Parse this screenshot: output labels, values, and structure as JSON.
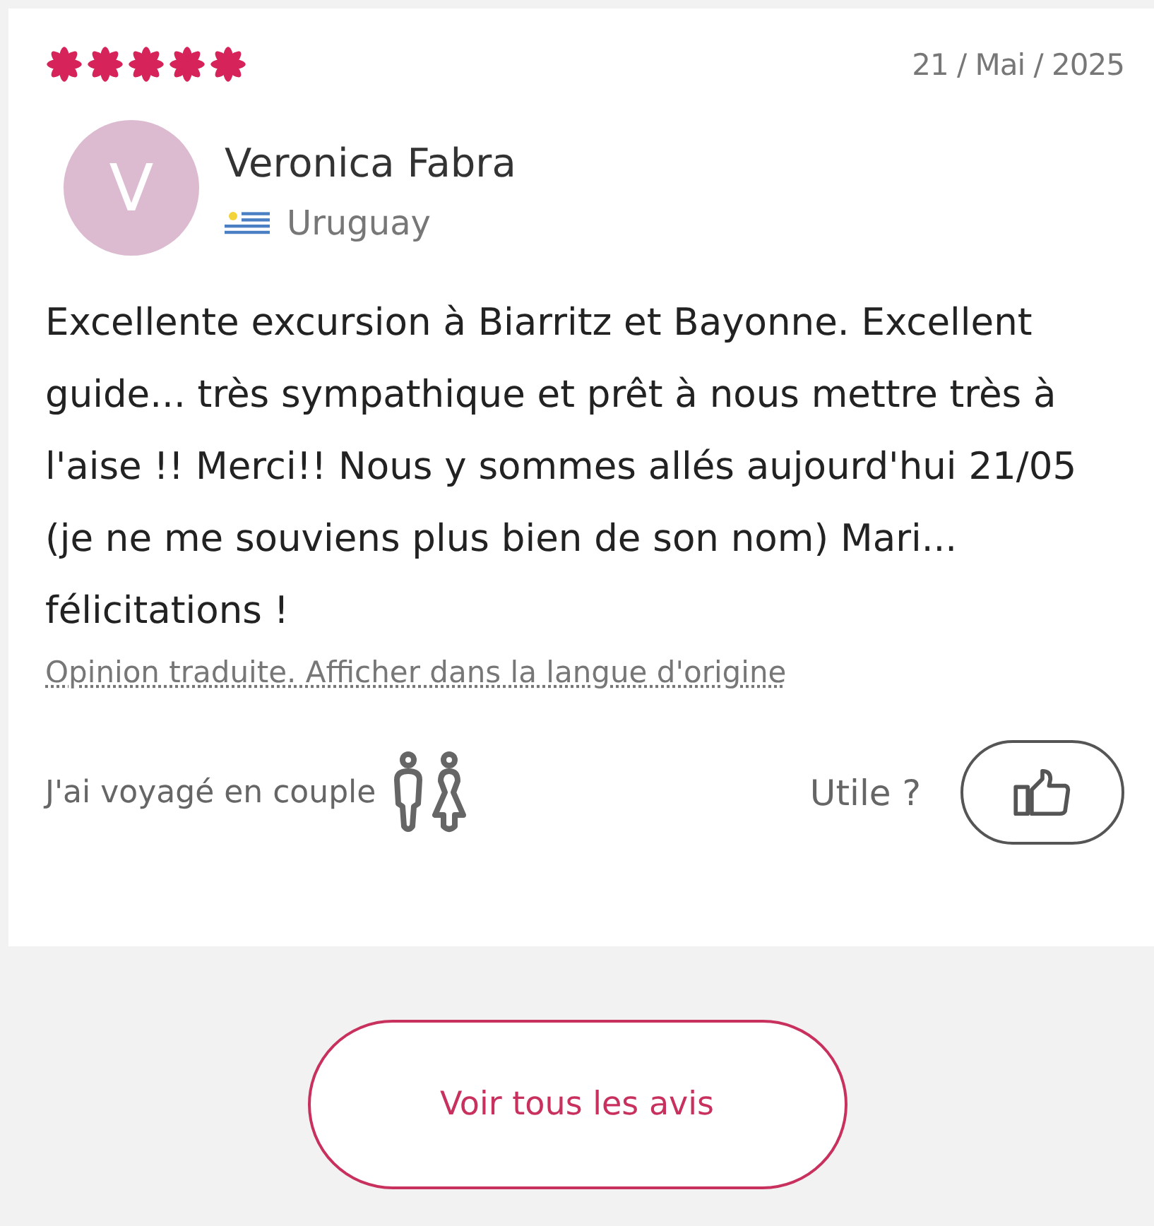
{
  "review": {
    "stars": 5,
    "date": "21 / Mai / 2025",
    "avatar_initial": "V",
    "author": "Veronica Fabra",
    "country": "Uruguay",
    "text": "Excellente excursion à Biarritz et Bayonne. Excellent guide... très sympathique et prêt à nous mettre très à l'aise !! Merci!! Nous y sommes allés aujourd'hui 21/05 (je ne me souviens plus bien de son nom) Mari... félicitations !",
    "translation_link": "Opinion traduite. Afficher dans la langue d'origine",
    "travel_type": "J'ai voyagé en couple",
    "helpful_label": "Utile ?"
  },
  "all_reviews_button": "Voir tous les avis"
}
